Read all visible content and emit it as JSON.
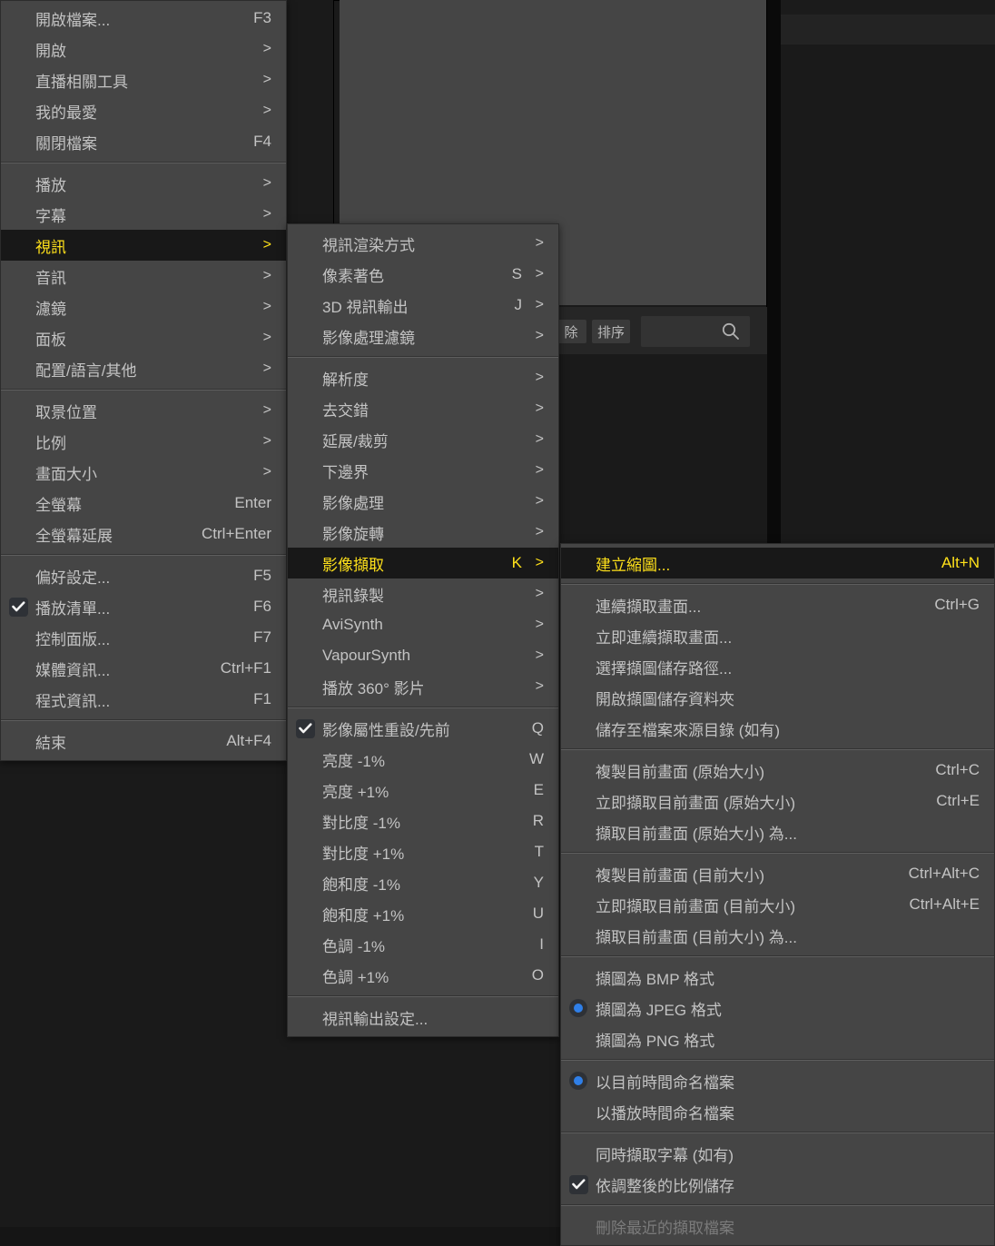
{
  "background": {
    "toolbar": {
      "delete_button": "除",
      "sort_button": "排序",
      "search_placeholder": "",
      "search_value": "",
      "search_icon": "search-icon"
    }
  },
  "colors": {
    "menu_bg": "#454545",
    "menu_text": "#c3c3c3",
    "highlight_bg": "#181818",
    "highlight_text": "#ffe11a",
    "disabled_text": "#7b7b7b",
    "radio_dot": "#2f7fe8",
    "separator": "#5e5e5e"
  },
  "menus": [
    {
      "id": "main-menu",
      "name": "main-context-menu",
      "items": [
        {
          "label": "開啟檔案...",
          "accel": "F3",
          "arrow": "",
          "state": "normal",
          "mark": ""
        },
        {
          "label": "開啟",
          "accel": "",
          "arrow": ">",
          "state": "normal",
          "mark": ""
        },
        {
          "label": "直播相關工具",
          "accel": "",
          "arrow": ">",
          "state": "normal",
          "mark": ""
        },
        {
          "label": "我的最愛",
          "accel": "",
          "arrow": ">",
          "state": "normal",
          "mark": ""
        },
        {
          "label": "關閉檔案",
          "accel": "F4",
          "arrow": "",
          "state": "normal",
          "mark": ""
        },
        {
          "separator": true
        },
        {
          "label": "播放",
          "accel": "",
          "arrow": ">",
          "state": "normal",
          "mark": ""
        },
        {
          "label": "字幕",
          "accel": "",
          "arrow": ">",
          "state": "normal",
          "mark": ""
        },
        {
          "label": "視訊",
          "accel": "",
          "arrow": ">",
          "state": "highlight",
          "mark": ""
        },
        {
          "label": "音訊",
          "accel": "",
          "arrow": ">",
          "state": "normal",
          "mark": ""
        },
        {
          "label": "濾鏡",
          "accel": "",
          "arrow": ">",
          "state": "normal",
          "mark": ""
        },
        {
          "label": "面板",
          "accel": "",
          "arrow": ">",
          "state": "normal",
          "mark": ""
        },
        {
          "label": "配置/語言/其他",
          "accel": "",
          "arrow": ">",
          "state": "normal",
          "mark": ""
        },
        {
          "separator": true
        },
        {
          "label": "取景位置",
          "accel": "",
          "arrow": ">",
          "state": "normal",
          "mark": ""
        },
        {
          "label": "比例",
          "accel": "",
          "arrow": ">",
          "state": "normal",
          "mark": ""
        },
        {
          "label": "畫面大小",
          "accel": "",
          "arrow": ">",
          "state": "normal",
          "mark": ""
        },
        {
          "label": "全螢幕",
          "accel": "Enter",
          "arrow": "",
          "state": "normal",
          "mark": ""
        },
        {
          "label": "全螢幕延展",
          "accel": "Ctrl+Enter",
          "arrow": "",
          "state": "normal",
          "mark": ""
        },
        {
          "separator": true
        },
        {
          "label": "偏好設定...",
          "accel": "F5",
          "arrow": "",
          "state": "normal",
          "mark": ""
        },
        {
          "label": "播放清單...",
          "accel": "F6",
          "arrow": "",
          "state": "normal",
          "mark": "check"
        },
        {
          "label": "控制面版...",
          "accel": "F7",
          "arrow": "",
          "state": "normal",
          "mark": ""
        },
        {
          "label": "媒體資訊...",
          "accel": "Ctrl+F1",
          "arrow": "",
          "state": "normal",
          "mark": ""
        },
        {
          "label": "程式資訊...",
          "accel": "F1",
          "arrow": "",
          "state": "normal",
          "mark": ""
        },
        {
          "separator": true
        },
        {
          "label": "結束",
          "accel": "Alt+F4",
          "arrow": "",
          "state": "normal",
          "mark": ""
        }
      ]
    },
    {
      "id": "video-submenu",
      "name": "video-submenu",
      "items": [
        {
          "label": "視訊渲染方式",
          "accel": "",
          "arrow": ">",
          "state": "normal",
          "mark": ""
        },
        {
          "label": "像素著色",
          "accel": "S",
          "arrow": ">",
          "state": "normal",
          "mark": ""
        },
        {
          "label": "3D 視訊輸出",
          "accel": "J",
          "arrow": ">",
          "state": "normal",
          "mark": ""
        },
        {
          "label": "影像處理濾鏡",
          "accel": "",
          "arrow": ">",
          "state": "normal",
          "mark": ""
        },
        {
          "separator": true
        },
        {
          "label": "解析度",
          "accel": "",
          "arrow": ">",
          "state": "normal",
          "mark": ""
        },
        {
          "label": "去交錯",
          "accel": "",
          "arrow": ">",
          "state": "normal",
          "mark": ""
        },
        {
          "label": "延展/裁剪",
          "accel": "",
          "arrow": ">",
          "state": "normal",
          "mark": ""
        },
        {
          "label": "下邊界",
          "accel": "",
          "arrow": ">",
          "state": "normal",
          "mark": ""
        },
        {
          "label": "影像處理",
          "accel": "",
          "arrow": ">",
          "state": "normal",
          "mark": ""
        },
        {
          "label": "影像旋轉",
          "accel": "",
          "arrow": ">",
          "state": "normal",
          "mark": ""
        },
        {
          "label": "影像擷取",
          "accel": "K",
          "arrow": ">",
          "state": "highlight",
          "mark": ""
        },
        {
          "label": "視訊錄製",
          "accel": "",
          "arrow": ">",
          "state": "normal",
          "mark": ""
        },
        {
          "label": "AviSynth",
          "accel": "",
          "arrow": ">",
          "state": "normal",
          "mark": ""
        },
        {
          "label": "VapourSynth",
          "accel": "",
          "arrow": ">",
          "state": "normal",
          "mark": ""
        },
        {
          "label": "播放 360° 影片",
          "accel": "",
          "arrow": ">",
          "state": "normal",
          "mark": ""
        },
        {
          "separator": true
        },
        {
          "label": "影像屬性重設/先前",
          "accel": "Q",
          "arrow": "",
          "state": "normal",
          "mark": "check"
        },
        {
          "label": "亮度 -1%",
          "accel": "W",
          "arrow": "",
          "state": "normal",
          "mark": ""
        },
        {
          "label": "亮度 +1%",
          "accel": "E",
          "arrow": "",
          "state": "normal",
          "mark": ""
        },
        {
          "label": "對比度 -1%",
          "accel": "R",
          "arrow": "",
          "state": "normal",
          "mark": ""
        },
        {
          "label": "對比度 +1%",
          "accel": "T",
          "arrow": "",
          "state": "normal",
          "mark": ""
        },
        {
          "label": "飽和度 -1%",
          "accel": "Y",
          "arrow": "",
          "state": "normal",
          "mark": ""
        },
        {
          "label": "飽和度 +1%",
          "accel": "U",
          "arrow": "",
          "state": "normal",
          "mark": ""
        },
        {
          "label": "色調 -1%",
          "accel": "I",
          "arrow": "",
          "state": "normal",
          "mark": ""
        },
        {
          "label": "色調 +1%",
          "accel": "O",
          "arrow": "",
          "state": "normal",
          "mark": ""
        },
        {
          "separator": true
        },
        {
          "label": "視訊輸出設定...",
          "accel": "",
          "arrow": "",
          "state": "normal",
          "mark": ""
        }
      ]
    },
    {
      "id": "capture-submenu",
      "name": "image-capture-submenu",
      "items": [
        {
          "label": "建立縮圖...",
          "accel": "Alt+N",
          "arrow": "",
          "state": "highlight",
          "mark": ""
        },
        {
          "separator": true
        },
        {
          "label": "連續擷取畫面...",
          "accel": "Ctrl+G",
          "arrow": "",
          "state": "normal",
          "mark": ""
        },
        {
          "label": "立即連續擷取畫面...",
          "accel": "",
          "arrow": "",
          "state": "normal",
          "mark": ""
        },
        {
          "label": "選擇擷圖儲存路徑...",
          "accel": "",
          "arrow": "",
          "state": "normal",
          "mark": ""
        },
        {
          "label": "開啟擷圖儲存資料夾",
          "accel": "",
          "arrow": "",
          "state": "normal",
          "mark": ""
        },
        {
          "label": "儲存至檔案來源目錄 (如有)",
          "accel": "",
          "arrow": "",
          "state": "normal",
          "mark": ""
        },
        {
          "separator": true
        },
        {
          "label": "複製目前畫面 (原始大小)",
          "accel": "Ctrl+C",
          "arrow": "",
          "state": "normal",
          "mark": ""
        },
        {
          "label": "立即擷取目前畫面 (原始大小)",
          "accel": "Ctrl+E",
          "arrow": "",
          "state": "normal",
          "mark": ""
        },
        {
          "label": "擷取目前畫面 (原始大小) 為...",
          "accel": "",
          "arrow": "",
          "state": "normal",
          "mark": ""
        },
        {
          "separator": true
        },
        {
          "label": "複製目前畫面 (目前大小)",
          "accel": "Ctrl+Alt+C",
          "arrow": "",
          "state": "normal",
          "mark": ""
        },
        {
          "label": "立即擷取目前畫面 (目前大小)",
          "accel": "Ctrl+Alt+E",
          "arrow": "",
          "state": "normal",
          "mark": ""
        },
        {
          "label": "擷取目前畫面 (目前大小) 為...",
          "accel": "",
          "arrow": "",
          "state": "normal",
          "mark": ""
        },
        {
          "separator": true
        },
        {
          "label": "擷圖為 BMP 格式",
          "accel": "",
          "arrow": "",
          "state": "normal",
          "mark": ""
        },
        {
          "label": "擷圖為 JPEG 格式",
          "accel": "",
          "arrow": "",
          "state": "normal",
          "mark": "radio"
        },
        {
          "label": "擷圖為 PNG 格式",
          "accel": "",
          "arrow": "",
          "state": "normal",
          "mark": ""
        },
        {
          "separator": true
        },
        {
          "label": "以目前時間命名檔案",
          "accel": "",
          "arrow": "",
          "state": "normal",
          "mark": "radio"
        },
        {
          "label": "以播放時間命名檔案",
          "accel": "",
          "arrow": "",
          "state": "normal",
          "mark": ""
        },
        {
          "separator": true
        },
        {
          "label": "同時擷取字幕 (如有)",
          "accel": "",
          "arrow": "",
          "state": "normal",
          "mark": ""
        },
        {
          "label": "依調整後的比例儲存",
          "accel": "",
          "arrow": "",
          "state": "normal",
          "mark": "check"
        },
        {
          "separator": true
        },
        {
          "label": "刪除最近的擷取檔案",
          "accel": "",
          "arrow": "",
          "state": "disabled",
          "mark": ""
        }
      ]
    }
  ]
}
